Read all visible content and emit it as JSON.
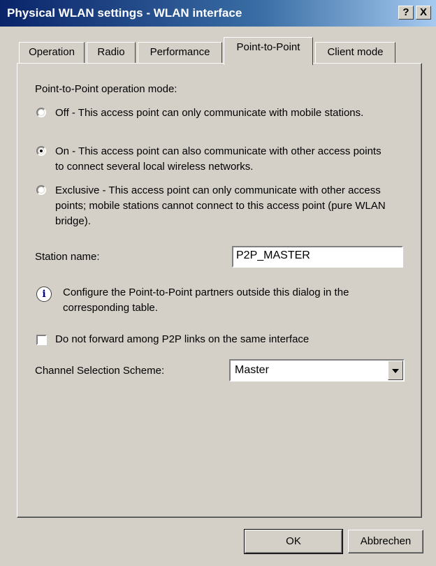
{
  "window": {
    "title": "Physical WLAN settings - WLAN interface",
    "help_label": "?",
    "close_label": "X"
  },
  "tabs": [
    {
      "label": "Operation"
    },
    {
      "label": "Radio"
    },
    {
      "label": "Performance"
    },
    {
      "label": "Point-to-Point",
      "active": true
    },
    {
      "label": "Client mode"
    }
  ],
  "p2p": {
    "mode_label": "Point-to-Point operation mode:",
    "options": [
      {
        "label": "Off - This access point can only communicate with mobile stations.",
        "selected": false
      },
      {
        "label": "On - This access point can also communicate with other access points to connect several local wireless networks.",
        "selected": true
      },
      {
        "label": "Exclusive - This access point can only communicate with other access points; mobile stations cannot connect to this access point (pure WLAN bridge).",
        "selected": false
      }
    ],
    "station_name_label": "Station name:",
    "station_name_value": "P2P_MASTER",
    "info_text": "Configure the Point-to-Point partners outside this dialog in the corresponding table.",
    "no_forward_label": "Do not forward among P2P links on the same interface",
    "no_forward_checked": false,
    "channel_scheme_label": "Channel Selection Scheme:",
    "channel_scheme_value": "Master"
  },
  "buttons": {
    "ok_label": "OK",
    "cancel_label": "Abbrechen"
  },
  "icons": {
    "info": "info-icon",
    "dropdown": "chevron-down-icon"
  }
}
